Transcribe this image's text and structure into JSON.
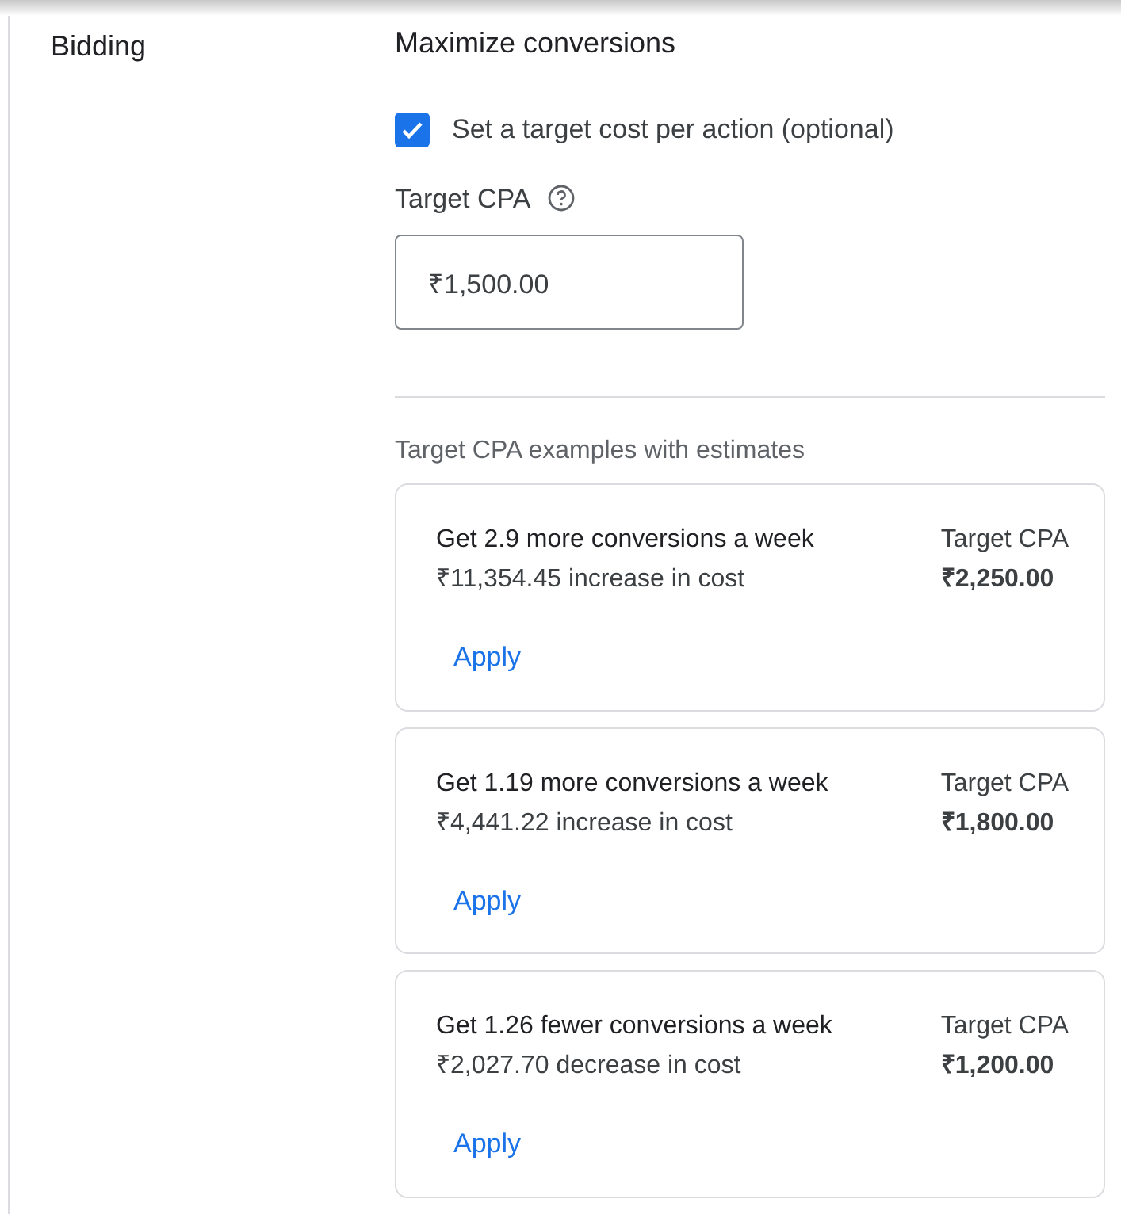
{
  "section_label": "Bidding",
  "strategy": "Maximize conversions",
  "target_checkbox": {
    "label": "Set a target cost per action (optional)",
    "checked": true
  },
  "target_field": {
    "label": "Target CPA",
    "value": "₹1,500.00"
  },
  "examples": {
    "heading": "Target CPA examples with estimates",
    "cards": [
      {
        "title": "Get 2.9 more conversions a week",
        "cost": "₹11,354.45 increase in cost",
        "cpa_label": "Target CPA",
        "cpa_value": "₹2,250.00",
        "action": "Apply"
      },
      {
        "title": "Get 1.19 more conversions a week",
        "cost": "₹4,441.22 increase in cost",
        "cpa_label": "Target CPA",
        "cpa_value": "₹1,800.00",
        "action": "Apply"
      },
      {
        "title": "Get 1.26 fewer conversions a week",
        "cost": "₹2,027.70 decrease in cost",
        "cpa_label": "Target CPA",
        "cpa_value": "₹1,200.00",
        "action": "Apply"
      }
    ]
  }
}
